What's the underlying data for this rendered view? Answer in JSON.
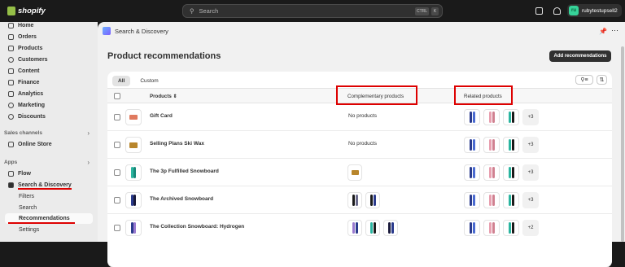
{
  "topbar": {
    "logo_text": "shopify",
    "search_placeholder": "Search",
    "kbd_ctrl": "CTRL",
    "kbd_k": "K",
    "store_name": "rubytestupsell2",
    "store_initials": "ru"
  },
  "sidebar": {
    "items": [
      {
        "label": "Home",
        "icon": "home-icon"
      },
      {
        "label": "Orders",
        "icon": "orders-icon"
      },
      {
        "label": "Products",
        "icon": "tag-icon"
      },
      {
        "label": "Customers",
        "icon": "person-icon"
      },
      {
        "label": "Content",
        "icon": "content-icon"
      },
      {
        "label": "Finance",
        "icon": "bank-icon"
      },
      {
        "label": "Analytics",
        "icon": "chart-icon"
      },
      {
        "label": "Marketing",
        "icon": "target-icon"
      },
      {
        "label": "Discounts",
        "icon": "discount-icon"
      }
    ],
    "sales_channels_label": "Sales channels",
    "online_store_label": "Online Store",
    "apps_label": "Apps",
    "flow_label": "Flow",
    "search_discovery_label": "Search & Discovery",
    "sub_items": [
      "Filters",
      "Search",
      "Recommendations",
      "Settings"
    ]
  },
  "main": {
    "breadcrumb": "Search & Discovery",
    "title": "Product recommendations",
    "add_button": "Add recommendations",
    "tabs": [
      "All",
      "Custom"
    ],
    "columns": {
      "products": "Products",
      "complementary": "Complementary products",
      "related": "Related products"
    },
    "rows": [
      {
        "name": "Gift Card",
        "complementary": "No products",
        "related_more": "+3"
      },
      {
        "name": "Selling Plans Ski Wax",
        "complementary": "No products",
        "related_more": "+3"
      },
      {
        "name": "The 3p Fulfilled Snowboard",
        "complementary": "",
        "related_more": "+3"
      },
      {
        "name": "The Archived Snowboard",
        "complementary": "",
        "related_more": "+3"
      },
      {
        "name": "The Collection Snowboard: Hydrogen",
        "complementary": "",
        "related_more": "+2"
      }
    ]
  },
  "colors": {
    "highlight": "#dd0000",
    "topbar": "#1a1a1a",
    "sidebar": "#ebebeb"
  }
}
